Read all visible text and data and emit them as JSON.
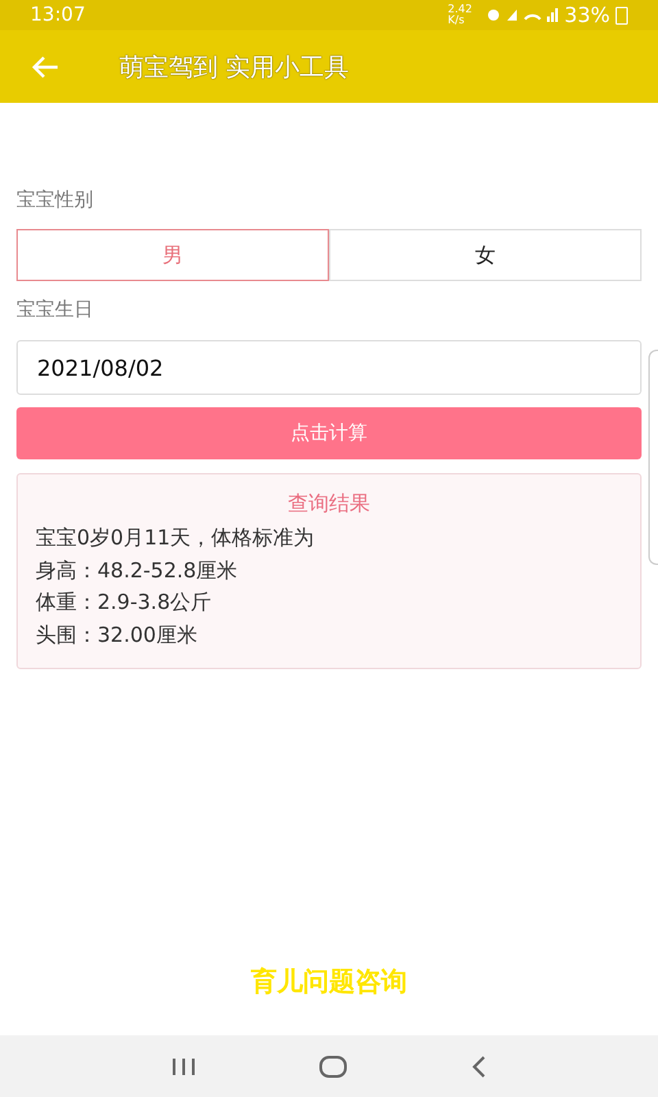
{
  "status_bar": {
    "time": "13:07",
    "net_speed": "2.42 K/s",
    "battery": "33%"
  },
  "app_bar": {
    "title": "萌宝驾到 实用小工具"
  },
  "gender": {
    "label": "宝宝性别",
    "options": [
      {
        "label": "男",
        "selected": true
      },
      {
        "label": "女",
        "selected": false
      }
    ]
  },
  "birthday": {
    "label": "宝宝生日",
    "value": "2021/08/02"
  },
  "calculate_button": "点击计算",
  "result": {
    "title": "查询结果",
    "lines": [
      "宝宝0岁0月11天，体格标准为",
      "身高：48.2-52.8厘米",
      "体重：2.9-3.8公斤",
      "头围：32.00厘米"
    ]
  },
  "footer_link": "育儿问题咨询"
}
